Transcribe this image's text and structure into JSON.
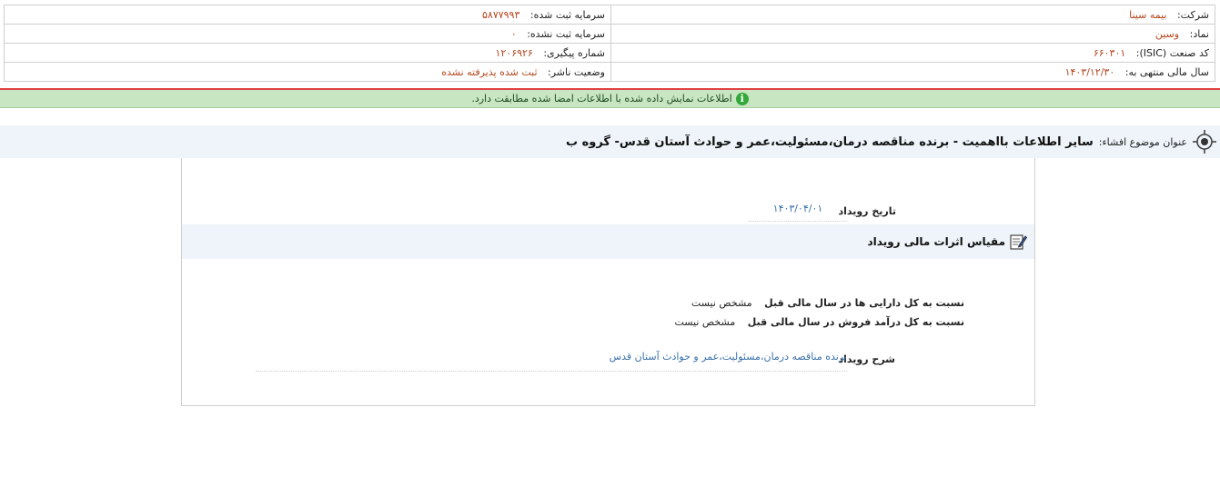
{
  "info": {
    "company_label": "شرکت:",
    "company_value": "بیمه سینا",
    "symbol_label": "نماد:",
    "symbol_value": "وسین",
    "isic_label": "کد صنعت (ISIC):",
    "isic_value": "۶۶۰۳۰۱",
    "fiscal_label": "سال مالی منتهی به:",
    "fiscal_value": "۱۴۰۳/۱۲/۳۰",
    "reg_capital_label": "سرمایه ثبت شده:",
    "reg_capital_value": "۵۸۷۷۹۹۳",
    "unreg_capital_label": "سرمایه ثبت نشده:",
    "unreg_capital_value": "۰",
    "tracking_label": "شماره پیگیری:",
    "tracking_value": "۱۲۰۶۹۲۶",
    "publisher_status_label": "وضعیت ناشر:",
    "publisher_status_value": "ثبت شده پذیرفته نشده"
  },
  "banner": {
    "text": "اطلاعات نمایش داده شده با اطلاعات امضا شده مطابقت دارد."
  },
  "subject": {
    "label": "عنوان موضوع افشاء:",
    "title": "سایر اطلاعات بااهمیت - برنده مناقصه درمان،مسئولیت،عمر و حوادث آستان قدس- گروه ب"
  },
  "event": {
    "date_label": "تاریخ رویداد",
    "date_value": "۱۴۰۳/۰۴/۰۱",
    "section_title": "مقیاس اثرات مالی رویداد",
    "assets_label": "نسبت به کل دارایی ها در سال مالی قبل",
    "assets_value": "مشخص نیست",
    "sales_label": "نسبت به کل درآمد فروش در سال مالی قبل",
    "sales_value": "مشخص نیست",
    "desc_label": "شرح رویداد",
    "desc_value": "برنده مناقصه درمان،مسئولیت،عمر و حوادث آستان قدس"
  }
}
